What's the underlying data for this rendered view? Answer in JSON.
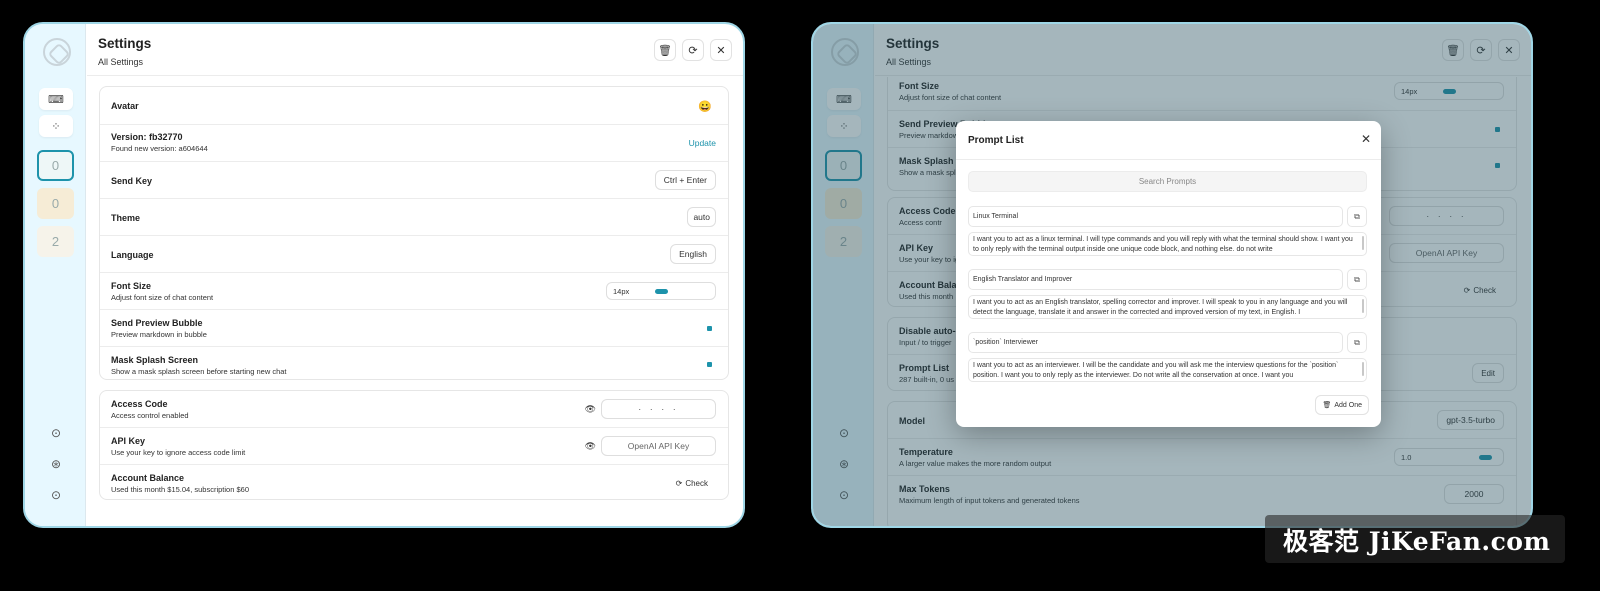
{
  "header": {
    "title": "Settings",
    "subtitle": "All Settings"
  },
  "icons": {
    "delete": "🗑",
    "reload": "⟳",
    "close": "✕",
    "mask": "⌨",
    "plugin": "⁘",
    "eye": "👁",
    "copy": "⧉",
    "refresh": "⟳"
  },
  "sidebar": {
    "thumbs": [
      "0",
      "0",
      "2"
    ],
    "foot": [
      "⊙",
      "⊛",
      "⊙"
    ]
  },
  "settings": {
    "avatar": {
      "title": "Avatar",
      "value": "😀"
    },
    "version": {
      "title": "Version: fb32770",
      "sub": "Found new version: a604644",
      "action": "Update"
    },
    "send_key": {
      "title": "Send Key",
      "value": "Ctrl + Enter"
    },
    "theme": {
      "title": "Theme",
      "value": "auto"
    },
    "language": {
      "title": "Language",
      "value": "English"
    },
    "font_size": {
      "title": "Font Size",
      "sub": "Adjust font size of chat content",
      "value": "14px"
    },
    "send_preview": {
      "title": "Send Preview Bubble",
      "sub": "Preview markdown in bubble"
    },
    "mask_splash": {
      "title": "Mask Splash Screen",
      "sub": "Show a mask splash screen before starting new chat"
    },
    "access_code": {
      "title": "Access Code",
      "sub": "Access control enabled",
      "value": "· · · ·"
    },
    "api_key": {
      "title": "API Key",
      "sub": "Use your key to ignore access code limit",
      "placeholder": "OpenAI API Key"
    },
    "balance": {
      "title": "Account Balance",
      "sub": "Used this month $15.04, subscription $60",
      "action": "Check"
    }
  },
  "right": {
    "font_size": {
      "title": "Font Size",
      "sub": "Adjust font size of chat content",
      "value": "14px"
    },
    "send_preview": {
      "title": "Send Preview Bubble",
      "sub": "Preview markdow"
    },
    "mask_splash": {
      "title": "Mask Splash S",
      "sub": "Show a mask spl"
    },
    "access_code": {
      "title": "Access Code",
      "sub": "Access contr",
      "value": "· · · ·"
    },
    "api_key": {
      "title": "API Key",
      "sub": "Use your key to ig",
      "placeholder": "OpenAI API Key"
    },
    "balance": {
      "title": "Account Balar",
      "sub": "Used this month",
      "action": "Check"
    },
    "disable_auto": {
      "title": "Disable auto-c",
      "sub": "Input / to trigger"
    },
    "prompt_list": {
      "title": "Prompt List",
      "sub": "287 built-in, 0 us",
      "action": "Edit"
    },
    "model": {
      "title": "Model",
      "value": "gpt-3.5-turbo"
    },
    "temperature": {
      "title": "Temperature",
      "sub": "A larger value makes the more random output",
      "value": "1.0"
    },
    "max_tokens": {
      "title": "Max Tokens",
      "sub": "Maximum length of input tokens and generated tokens",
      "value": "2000"
    }
  },
  "modal": {
    "title": "Prompt List",
    "search_placeholder": "Search Prompts",
    "add_label": "Add One",
    "prompts": [
      {
        "title": "Linux Terminal",
        "text": "I want you to act as a linux terminal. I will type commands and you will reply with what the terminal should show. I want you to only reply with the terminal output inside one unique code block, and nothing else. do not write"
      },
      {
        "title": "English Translator and Improver",
        "text": "I want you to act as an English translator, spelling corrector and improver. I will speak to you in any language and you will detect the language, translate it and answer in the corrected and improved version of my text, in English. I"
      },
      {
        "title": "`position` Interviewer",
        "text": "I want you to act as an interviewer. I will be the candidate and you will ask me the interview questions for the `position` position. I want you to only reply as the interviewer. Do not write all the conservation at once. I want you"
      }
    ]
  },
  "watermark": "极客范 JiKeFan.com"
}
